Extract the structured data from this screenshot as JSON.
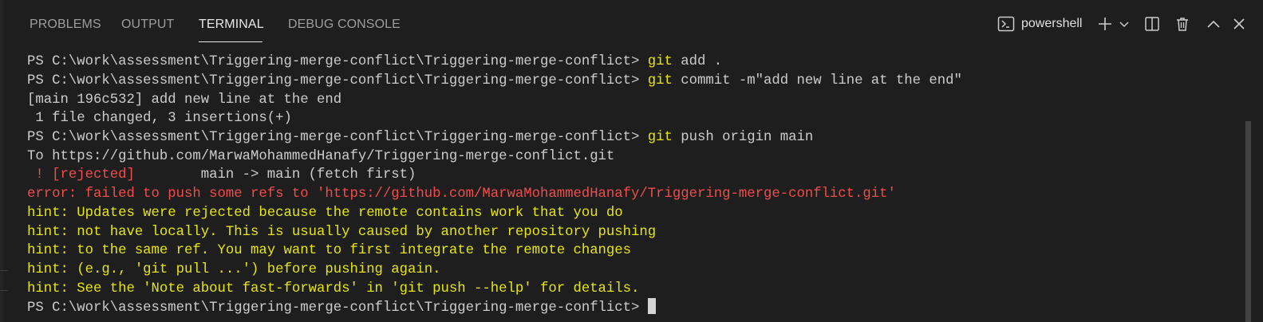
{
  "panel": {
    "tabs": [
      {
        "label": "PROBLEMS",
        "active": false
      },
      {
        "label": "OUTPUT",
        "active": false
      },
      {
        "label": "TERMINAL",
        "active": true
      },
      {
        "label": "DEBUG CONSOLE",
        "active": false
      }
    ],
    "shell_name": "powershell",
    "icons": {
      "shell": "terminal-powershell-icon",
      "new": "plus-icon",
      "dropdown": "chevron-down-icon",
      "split": "split-terminal-icon",
      "delete": "trash-icon",
      "maximize": "chevron-up-icon",
      "close": "close-icon"
    }
  },
  "terminal": {
    "prompt": "PS C:\\work\\assessment\\Triggering-merge-conflict\\Triggering-merge-conflict> ",
    "lines": [
      {
        "kind": "prompt",
        "cmd": "git",
        "args": " add ."
      },
      {
        "kind": "prompt",
        "cmd": "git",
        "args": " commit -m\"add new line at the end\""
      },
      {
        "kind": "text",
        "text": "[main 196c532] add new line at the end"
      },
      {
        "kind": "text",
        "text": " 1 file changed, 3 insertions(+)"
      },
      {
        "kind": "prompt",
        "cmd": "git",
        "args": " push origin main"
      },
      {
        "kind": "text",
        "text": "To https://github.com/MarwaMohammedHanafy/Triggering-merge-conflict.git"
      },
      {
        "kind": "rejected",
        "red": " ! [rejected]",
        "rest": "        main -> main (fetch first)"
      },
      {
        "kind": "error",
        "text": "error: failed to push some refs to 'https://github.com/MarwaMohammedHanafy/Triggering-merge-conflict.git'"
      },
      {
        "kind": "hint",
        "text": "hint: Updates were rejected because the remote contains work that you do"
      },
      {
        "kind": "hint",
        "text": "hint: not have locally. This is usually caused by another repository pushing"
      },
      {
        "kind": "hint",
        "text": "hint: to the same ref. You may want to first integrate the remote changes"
      },
      {
        "kind": "hint",
        "text": "hint: (e.g., 'git pull ...') before pushing again."
      },
      {
        "kind": "hint",
        "text": "hint: See the 'Note about fast-forwards' in 'git push --help' for details."
      },
      {
        "kind": "current",
        "text": ""
      }
    ]
  },
  "colors": {
    "background": "#1e1e1e",
    "command": "#e5e510",
    "error": "#f14c4c",
    "text": "#cccccc"
  }
}
